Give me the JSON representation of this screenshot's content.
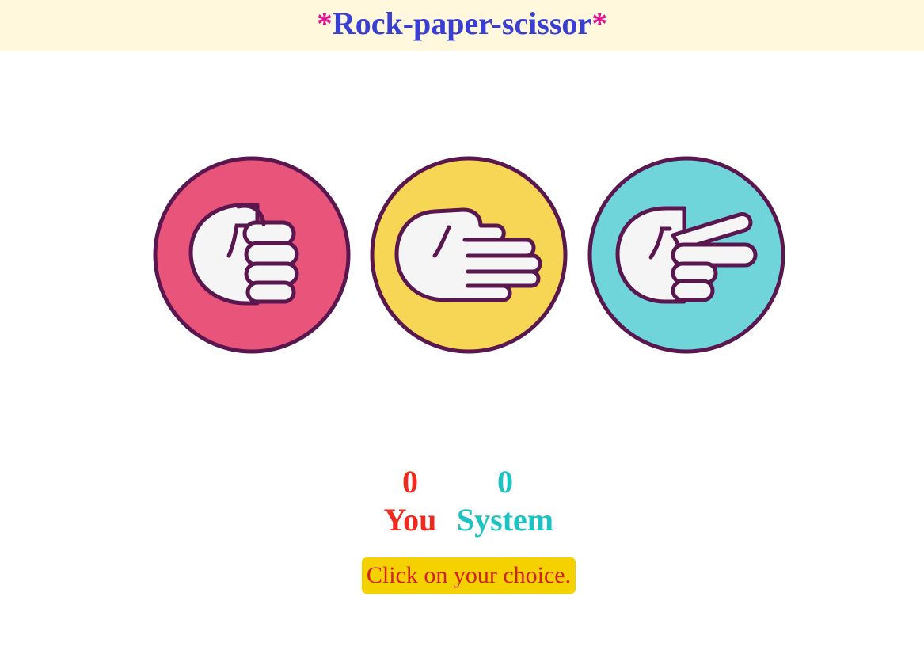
{
  "header": {
    "title_star_left": "*",
    "title_text": "Rock-paper-scissor",
    "title_star_right": "*"
  },
  "choices": [
    {
      "name": "rock",
      "color": "#e8547a",
      "icon": "fist-icon"
    },
    {
      "name": "paper",
      "color": "#f6d654",
      "icon": "flat-hand-icon"
    },
    {
      "name": "scissors",
      "color": "#70d4db",
      "icon": "two-finger-hand-icon"
    }
  ],
  "score": {
    "user_score": "0",
    "user_label": "You",
    "system_score": "0",
    "system_label": "System"
  },
  "message": "Click on your choice.",
  "colors": {
    "header_bg": "#fff8dc",
    "title": "#3a3fd4",
    "star": "#e0148c",
    "user": "#ee2b1e",
    "system": "#1dc3c3",
    "message_bg": "#f5d100",
    "message_text": "#d2202a",
    "outline": "#5a164f"
  }
}
